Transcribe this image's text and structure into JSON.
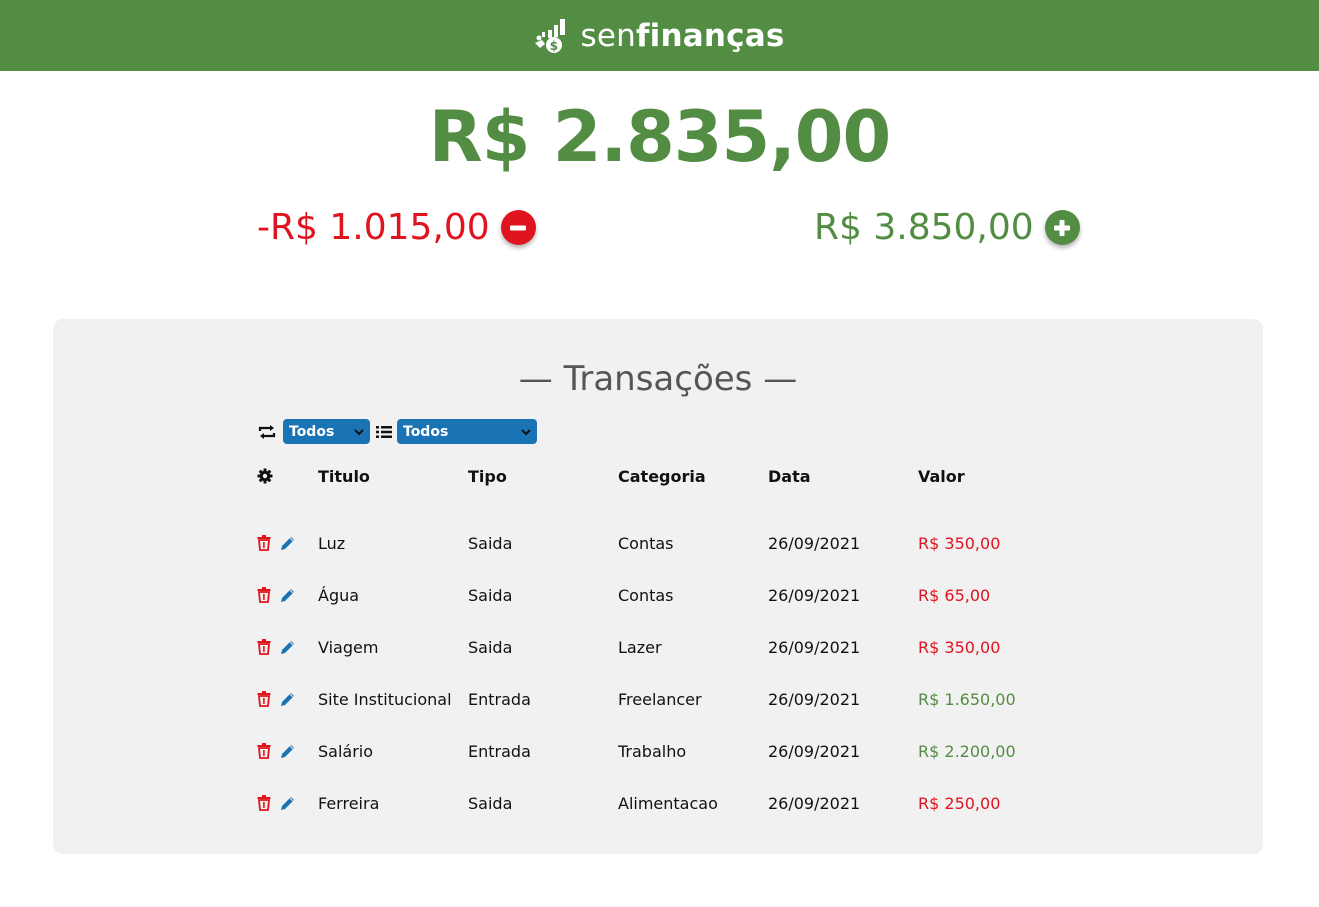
{
  "header": {
    "logo_light": "sen",
    "logo_bold": "finanças",
    "icon": "money-growth-icon",
    "background": "#538d43"
  },
  "balance": {
    "total": "R$ 2.835,00",
    "expenses": "-R$ 1.015,00",
    "income": "R$ 3.850,00",
    "expense_color": "#e0141e",
    "income_color": "#538d43"
  },
  "transactions": {
    "title": "— Transações —",
    "filters": {
      "type_icon": "repeat-icon",
      "type_value": "Todos",
      "category_icon": "list-icon",
      "category_value": "Todos"
    },
    "columns": {
      "actions_icon": "gear-icon",
      "title": "Titulo",
      "type": "Tipo",
      "category": "Categoria",
      "date": "Data",
      "value": "Valor"
    },
    "rows": [
      {
        "title": "Luz",
        "type": "Saida",
        "category": "Contas",
        "date": "26/09/2021",
        "value": "R$ 350,00",
        "kind": "out"
      },
      {
        "title": "Água",
        "type": "Saida",
        "category": "Contas",
        "date": "26/09/2021",
        "value": "R$ 65,00",
        "kind": "out"
      },
      {
        "title": "Viagem",
        "type": "Saida",
        "category": "Lazer",
        "date": "26/09/2021",
        "value": "R$ 350,00",
        "kind": "out"
      },
      {
        "title": "Site Institucional",
        "type": "Entrada",
        "category": "Freelancer",
        "date": "26/09/2021",
        "value": "R$ 1.650,00",
        "kind": "in"
      },
      {
        "title": "Salário",
        "type": "Entrada",
        "category": "Trabalho",
        "date": "26/09/2021",
        "value": "R$ 2.200,00",
        "kind": "in"
      },
      {
        "title": "Ferreira",
        "type": "Saida",
        "category": "Alimentacao",
        "date": "26/09/2021",
        "value": "R$ 250,00",
        "kind": "out"
      }
    ]
  }
}
